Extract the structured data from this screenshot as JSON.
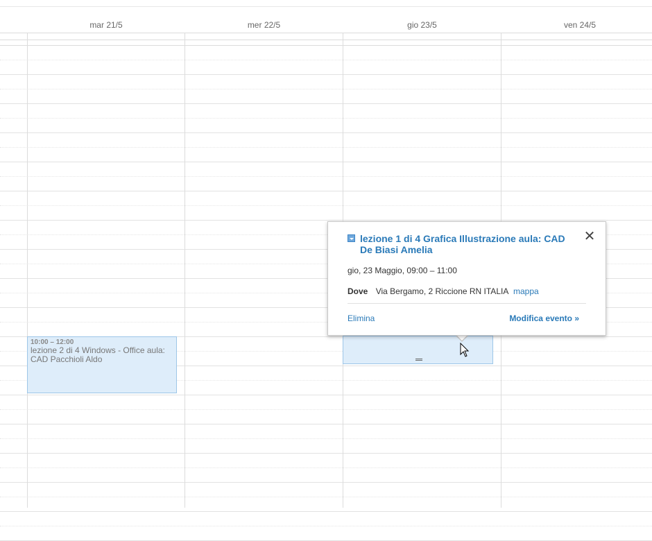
{
  "calendar": {
    "days": [
      {
        "label": "mar 21/5"
      },
      {
        "label": "mer 22/5"
      },
      {
        "label": "gio 23/5"
      },
      {
        "label": "ven 24/5"
      }
    ],
    "events": [
      {
        "time": "10:00 – 12:00",
        "title": "lezione 2 di 4 Windows - Office aula: CAD Pacchioli Aldo"
      }
    ]
  },
  "popup": {
    "title": "lezione 1 di 4 Grafica Illustrazione aula: CAD De Biasi Amelia",
    "when": "gio, 23 Maggio, 09:00 – 11:00",
    "where_label": "Dove",
    "where_value": "Via Bergamo, 2 Riccione RN ITALIA",
    "map_link": "mappa",
    "delete_label": "Elimina",
    "edit_label": "Modifica evento »",
    "close_glyph": "✕"
  },
  "colors": {
    "event_bg": "#deedfa",
    "event_border": "#9dc6e8",
    "link": "#2a7ab8"
  },
  "icons": {
    "close": "close-icon",
    "event_color": "dropdown-square-icon",
    "cursor": "mouse-pointer-icon",
    "resize": "resize-handle-icon"
  }
}
